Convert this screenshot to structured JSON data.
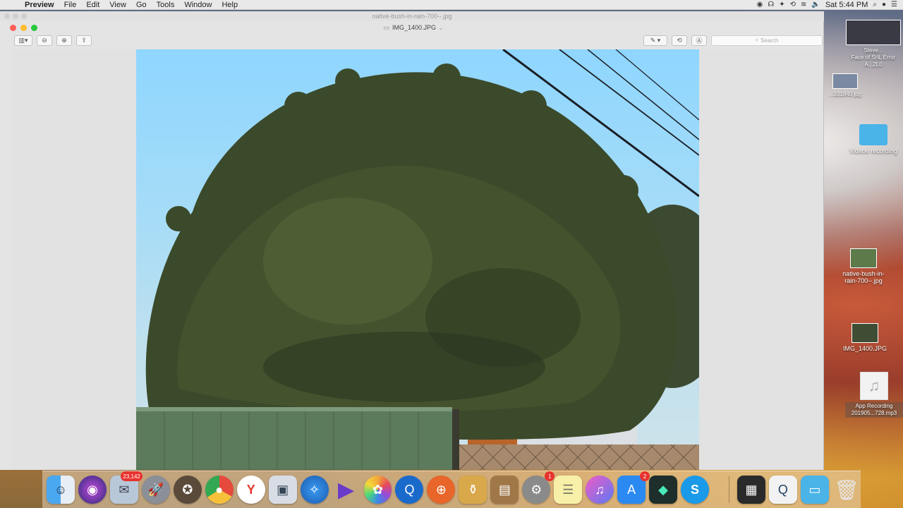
{
  "menubar": {
    "app_name": "Preview",
    "items": [
      "File",
      "Edit",
      "View",
      "Go",
      "Tools",
      "Window",
      "Help"
    ],
    "clock": "Sat 5:44 PM"
  },
  "window": {
    "back_title": "native-bush-in-rain-700--.jpg",
    "title": "IMG_1400.JPG",
    "search_placeholder": "Search"
  },
  "desktop_icons": [
    {
      "label": "Steve...",
      "label2": "Face of SriL Error A...2L0"
    },
    {
      "label": "...331840.jpg"
    },
    {
      "label": "Videoe recording"
    },
    {
      "label": "native-bush-in-rain-700--.jpg"
    },
    {
      "label": "IMG_1400.JPG"
    },
    {
      "label": "App Recording 201905...728.mp3"
    }
  ],
  "dock": {
    "mail_badge": "23,142",
    "settings_badge": "1",
    "appstore_badge": "2"
  },
  "colors": {
    "close": "#fd5f57",
    "minimize": "#febc2e",
    "maximize": "#28c840"
  }
}
